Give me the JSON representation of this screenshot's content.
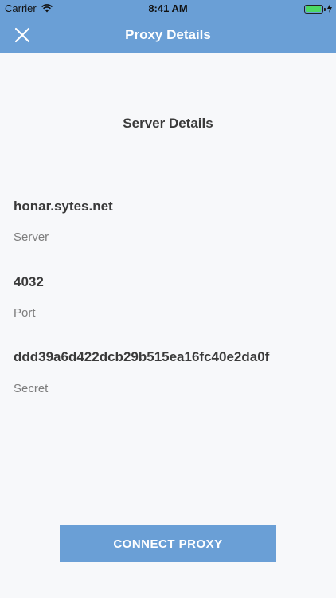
{
  "status_bar": {
    "carrier": "Carrier",
    "time": "8:41 AM",
    "wifi_icon": "wifi-icon",
    "battery_icon": "battery-icon",
    "charging_icon": "bolt-icon"
  },
  "nav": {
    "title": "Proxy Details",
    "close_icon": "close-icon",
    "background_color": "#6a9fd6"
  },
  "content": {
    "section_title": "Server Details",
    "server": {
      "value": "honar.sytes.net",
      "label": "Server"
    },
    "port": {
      "value": "4032",
      "label": "Port"
    },
    "secret": {
      "value": "ddd39a6d422dcb29b515ea16fc40e2da0f",
      "label": "Secret"
    }
  },
  "actions": {
    "connect_label": "CONNECT PROXY",
    "button_color": "#6a9fd6"
  }
}
